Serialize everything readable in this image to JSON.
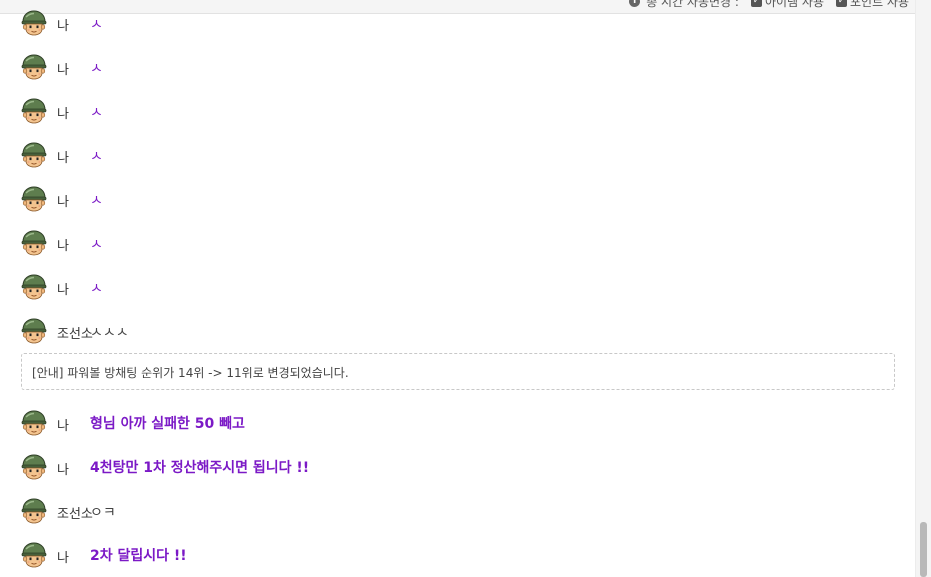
{
  "topbar": {
    "status_text": "총 시간 자동변경 :",
    "option_1": "아이템 사용",
    "option_2": "포인트 사용"
  },
  "icons": {
    "avatar": "soldier-avatar-icon",
    "info": "info-icon",
    "checkbox": "checkbox-checked-icon"
  },
  "colors": {
    "my_message": "#7b19c6",
    "other_message": "#444444",
    "notice_border": "#c8c8c8"
  },
  "messages": [
    {
      "name": "나",
      "text": "ㅅ"
    },
    {
      "name": "나",
      "text": "ㅅ"
    },
    {
      "name": "나",
      "text": "ㅅ"
    },
    {
      "name": "나",
      "text": "ㅅ"
    },
    {
      "name": "나",
      "text": "ㅅ"
    },
    {
      "name": "나",
      "text": "ㅅ"
    },
    {
      "name": "나",
      "text": "ㅅ"
    },
    {
      "name": "조선소",
      "text": "ㅅㅅㅅ"
    },
    {
      "name": "나",
      "text": "형님 아까 실패한 50 빼고"
    },
    {
      "name": "나",
      "text": "4천탕만 1차 정산해주시면 됩니다 !!"
    },
    {
      "name": "조선소",
      "text": "ㅇㅋ"
    },
    {
      "name": "나",
      "text": "2차 달립시다 !!"
    }
  ],
  "notice": "[안내] 파워볼 방채팅 순위가 14위 -> 11위로 변경되었습니다."
}
